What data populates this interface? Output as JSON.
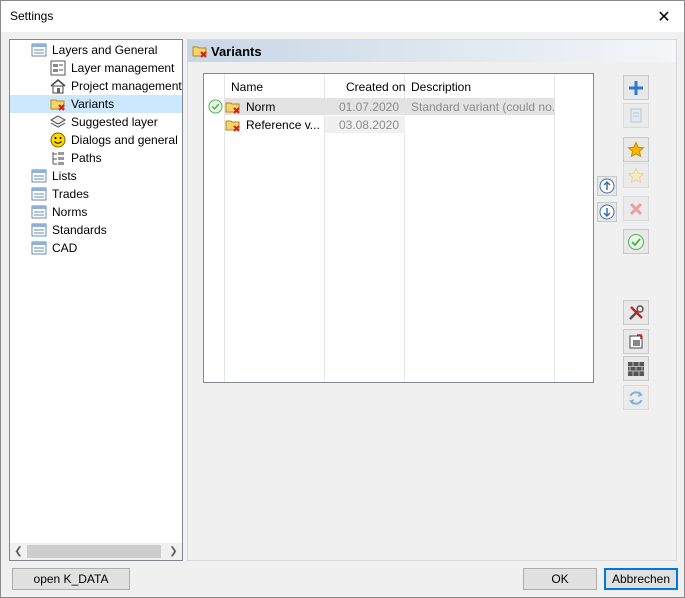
{
  "window": {
    "title": "Settings",
    "close_glyph": "✕"
  },
  "tree": {
    "items": [
      {
        "label": "Layers and General",
        "icon": "list-icon"
      },
      {
        "label": "Layer management",
        "icon": "layer-icon"
      },
      {
        "label": "Project management",
        "icon": "house-icon"
      },
      {
        "label": "Variants",
        "icon": "variant-folder-icon"
      },
      {
        "label": "Suggested layer",
        "icon": "stack-icon"
      },
      {
        "label": "Dialogs and general",
        "icon": "smiley-icon"
      },
      {
        "label": "Paths",
        "icon": "path-icon"
      },
      {
        "label": "Lists",
        "icon": "list-icon"
      },
      {
        "label": "Trades",
        "icon": "list-icon"
      },
      {
        "label": "Norms",
        "icon": "list-icon"
      },
      {
        "label": "Standards",
        "icon": "list-icon"
      },
      {
        "label": "CAD",
        "icon": "list-icon"
      }
    ],
    "selected": "Variants"
  },
  "panel": {
    "title": "Variants",
    "columns": {
      "name": "Name",
      "created": "Created on",
      "description": "Description"
    },
    "rows": [
      {
        "name": "Norm",
        "created": "01.07.2020",
        "description": "Standard variant (could no...",
        "active": true
      },
      {
        "name": "Reference v...",
        "created": "03.08.2020",
        "description": "",
        "active": false
      }
    ]
  },
  "toolbar": {
    "add": "plus-icon",
    "copy": "copy-icon",
    "favorite": "star-icon",
    "favorite_clear": "star-outline-icon",
    "delete": "delete-icon",
    "activate": "check-icon",
    "tools": "tools-icon",
    "export": "export-icon",
    "wall": "wall-icon",
    "refresh": "refresh-icon",
    "move_up": "arrow-up-icon",
    "move_down": "arrow-down-icon"
  },
  "footer": {
    "open_label": "open K_DATA",
    "ok_label": "OK",
    "cancel_label": "Abbrechen"
  },
  "colors": {
    "selection": "#cce8ff",
    "header_gradient_start": "#c8d6e6",
    "default_button_border": "#0078d7"
  }
}
